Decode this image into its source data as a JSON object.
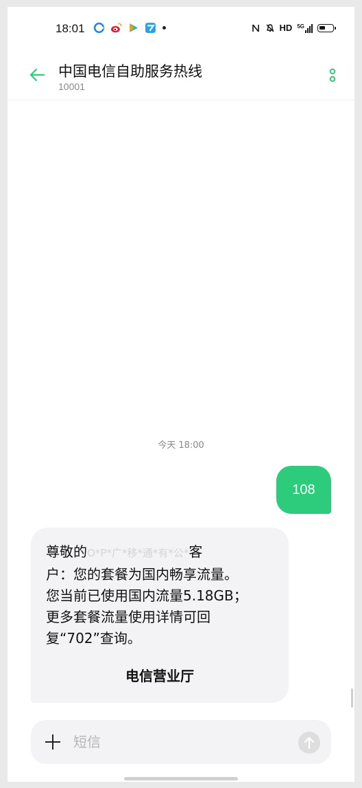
{
  "status_bar": {
    "time": "18:01",
    "hd": "HD",
    "network": "5G",
    "notification_icons": [
      "browser-icon",
      "weibo-icon",
      "video-player-icon",
      "app-icon"
    ],
    "system_icons": [
      "nfc-icon",
      "mute-icon",
      "signal-icon",
      "battery-icon"
    ]
  },
  "header": {
    "contact_name": "中国电信自助服务热线",
    "contact_number": "10001",
    "accent_color": "#2ccc7c"
  },
  "conversation": {
    "timestamp": "今天 18:00",
    "sent_message": "108",
    "received": {
      "line_start": "尊敬的",
      "masked_name": "O*P*广*移*通*有*公*",
      "line_end": "客",
      "body": "户：您的套餐为国内畅享流量。\n您当前已使用国内流量5.18GB；\n更多套餐流量使用详情可回\n复“702”查询。",
      "link_label": "电信营业厅"
    }
  },
  "composer": {
    "placeholder": "短信"
  }
}
